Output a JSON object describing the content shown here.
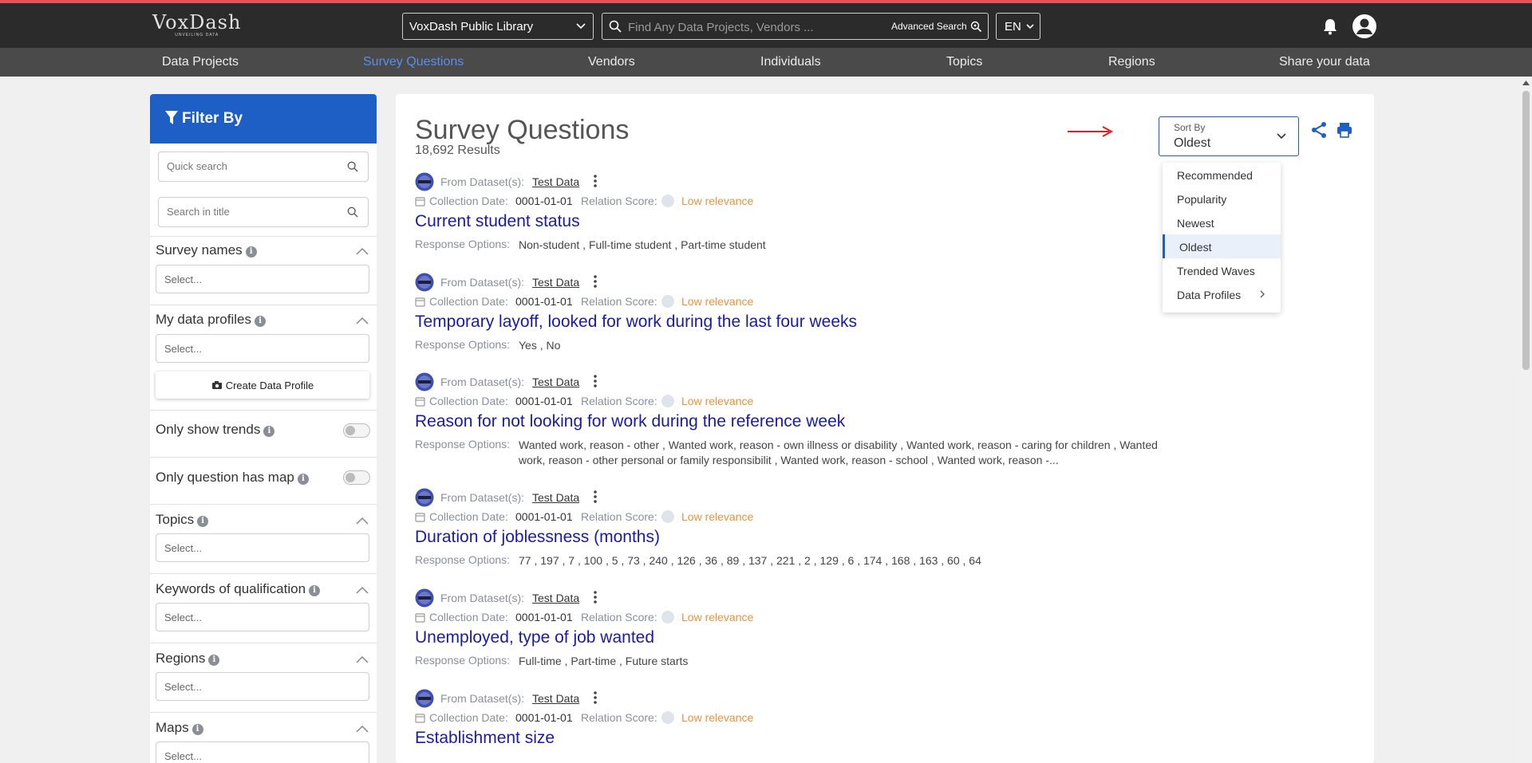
{
  "header": {
    "logo_name": "VoxDash",
    "logo_tagline": "UNVEILING DATA",
    "library_select": "VoxDash Public Library",
    "search_placeholder": "Find Any Data Projects, Vendors ...",
    "advanced_search": "Advanced Search",
    "language": "EN"
  },
  "nav": {
    "items": [
      "Data Projects",
      "Survey Questions",
      "Vendors",
      "Individuals",
      "Topics",
      "Regions",
      "Share your data"
    ],
    "active": "Survey Questions"
  },
  "sidebar": {
    "title": "Filter By",
    "quick_search_placeholder": "Quick search",
    "title_search_placeholder": "Search in title",
    "select_placeholder": "Select...",
    "create_profile_label": "Create Data Profile",
    "sections": {
      "survey_names": "Survey names",
      "my_data_profiles": "My data profiles",
      "only_trends": "Only show trends",
      "only_map": "Only question has map",
      "topics": "Topics",
      "keywords": "Keywords of qualification",
      "regions": "Regions",
      "maps": "Maps"
    }
  },
  "main": {
    "title": "Survey Questions",
    "results_count": "18,692 Results",
    "sort": {
      "label": "Sort By",
      "value": "Oldest",
      "options": [
        "Recommended",
        "Popularity",
        "Newest",
        "Oldest",
        "Trended Waves",
        "Data Profiles"
      ]
    },
    "labels": {
      "from_dataset": "From Dataset(s):",
      "collection_date": "Collection Date:",
      "relation_score": "Relation Score:",
      "response_options": "Response Options:"
    },
    "results": [
      {
        "dataset": "Test Data",
        "date": "0001-01-01",
        "relevance": "Low relevance",
        "title": "Current student status",
        "options": "Non-student , Full-time student , Part-time student"
      },
      {
        "dataset": "Test Data",
        "date": "0001-01-01",
        "relevance": "Low relevance",
        "title": "Temporary layoff, looked for work during the last four weeks",
        "options": "Yes , No"
      },
      {
        "dataset": "Test Data",
        "date": "0001-01-01",
        "relevance": "Low relevance",
        "title": "Reason for not looking for work during the reference week",
        "options": "Wanted work, reason - other , Wanted work, reason - own illness or disability , Wanted work, reason - caring for children , Wanted work, reason - other personal or family responsibilit , Wanted work, reason - school , Wanted work, reason -..."
      },
      {
        "dataset": "Test Data",
        "date": "0001-01-01",
        "relevance": "Low relevance",
        "title": "Duration of joblessness (months)",
        "options": "77 , 197 , 7 , 100 , 5 , 73 , 240 , 126 , 36 , 89 , 137 , 221 , 2 , 129 , 6 , 174 , 168 , 163 , 60 , 64"
      },
      {
        "dataset": "Test Data",
        "date": "0001-01-01",
        "relevance": "Low relevance",
        "title": "Unemployed, type of job wanted",
        "options": "Full-time , Part-time , Future starts"
      },
      {
        "dataset": "Test Data",
        "date": "0001-01-01",
        "relevance": "Low relevance",
        "title": "Establishment size",
        "options": ""
      }
    ]
  },
  "colors": {
    "accent": "#1d5fc4",
    "nav_active": "#5b8de8",
    "question_link": "#1a1aa8",
    "low_relevance": "#f0903a",
    "annotation_arrow": "#e02020"
  }
}
